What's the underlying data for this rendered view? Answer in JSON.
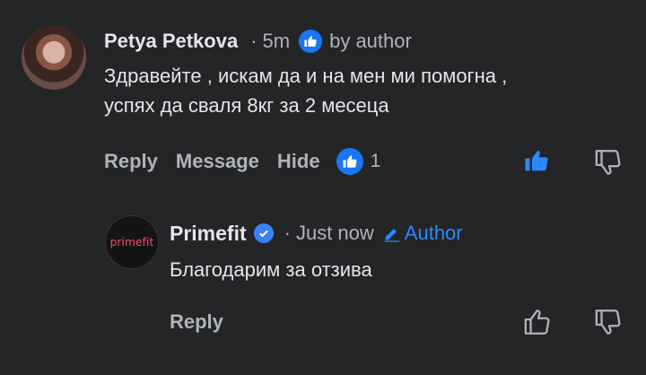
{
  "comment": {
    "author": "Petya Petkova",
    "dot": "·",
    "time": "5m",
    "liked_by": "by author",
    "text_line1": "Здравейте , искам да и на мен ми помогна ,",
    "text_line2": "успях да сваля 8кг за 2 месеца",
    "actions": {
      "reply": "Reply",
      "message": "Message",
      "hide": "Hide"
    },
    "like_count": "1"
  },
  "reply": {
    "author": "Primefit",
    "avatar_text": "primefit",
    "dot": "·",
    "time": "Just now",
    "badge": "Author",
    "text": "Благодарим за отзива",
    "actions": {
      "reply": "Reply"
    }
  },
  "colors": {
    "background": "#242526",
    "accent": "#2d88ff",
    "muted": "#b0b3b8"
  }
}
